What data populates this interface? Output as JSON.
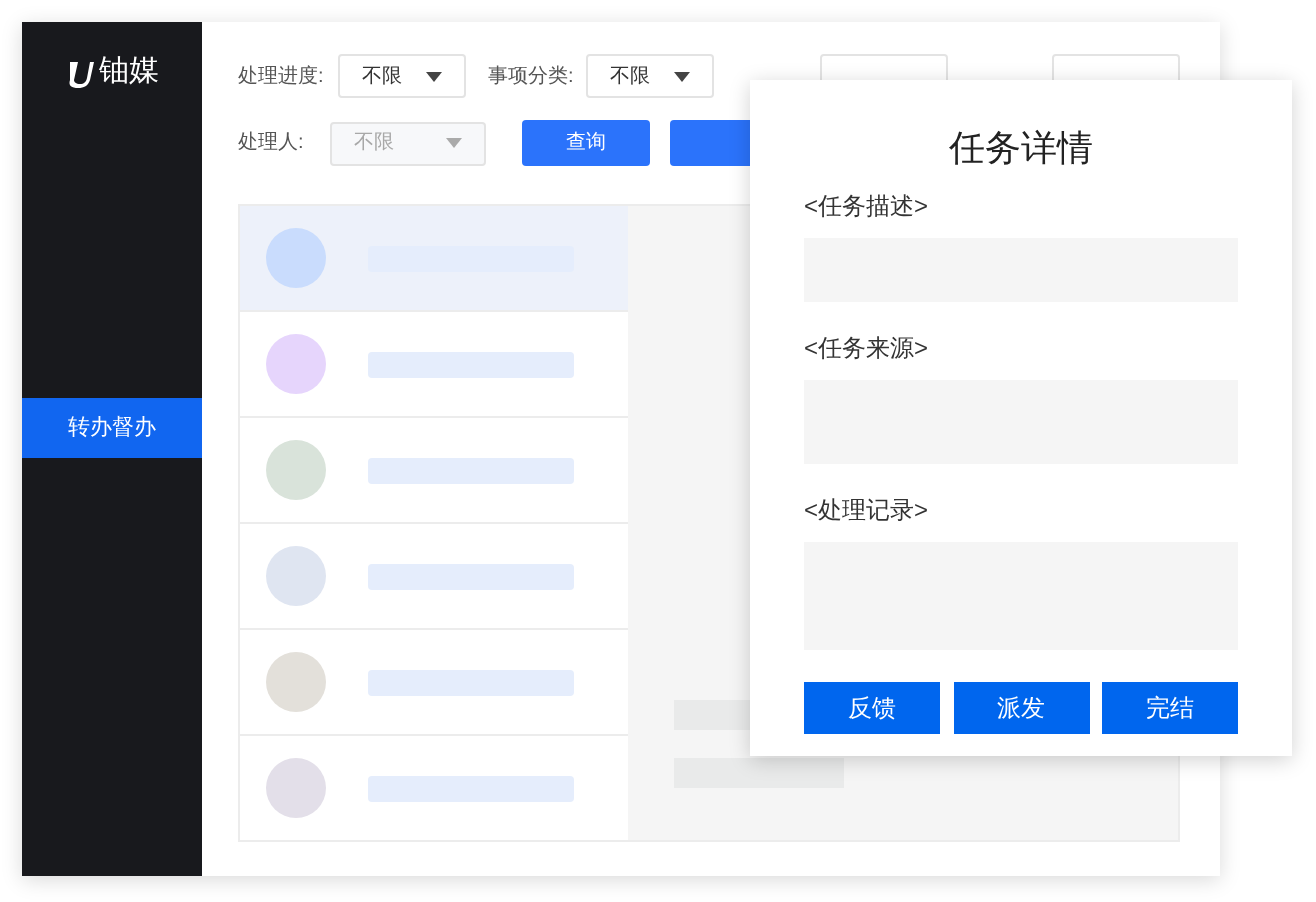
{
  "sidebar": {
    "logo_text": "铀媒",
    "items": [
      {
        "label": "转办督办",
        "selected": true
      }
    ]
  },
  "filters": [
    {
      "label": "处理进度:",
      "value": "不限",
      "disabled": false
    },
    {
      "label": "事项分类:",
      "value": "不限",
      "disabled": false
    },
    {
      "label": "处理人:",
      "value": "不限",
      "disabled": true
    }
  ],
  "actions": [
    "查询"
  ],
  "list": [
    {
      "color": "#c9dcfd",
      "selected": true
    },
    {
      "color": "#e6d5fc",
      "selected": false
    },
    {
      "color": "#d9e3da",
      "selected": false
    },
    {
      "color": "#dfe5f1",
      "selected": false
    },
    {
      "color": "#e3e0da",
      "selected": false
    },
    {
      "color": "#e3dfe9",
      "selected": false
    }
  ],
  "dialog": {
    "title": "任务详情",
    "sections": [
      {
        "label": "<任务描述>"
      },
      {
        "label": "<任务来源>"
      },
      {
        "label": "<处理记录>"
      }
    ],
    "buttons": [
      "反馈",
      "派发",
      "完结"
    ]
  }
}
